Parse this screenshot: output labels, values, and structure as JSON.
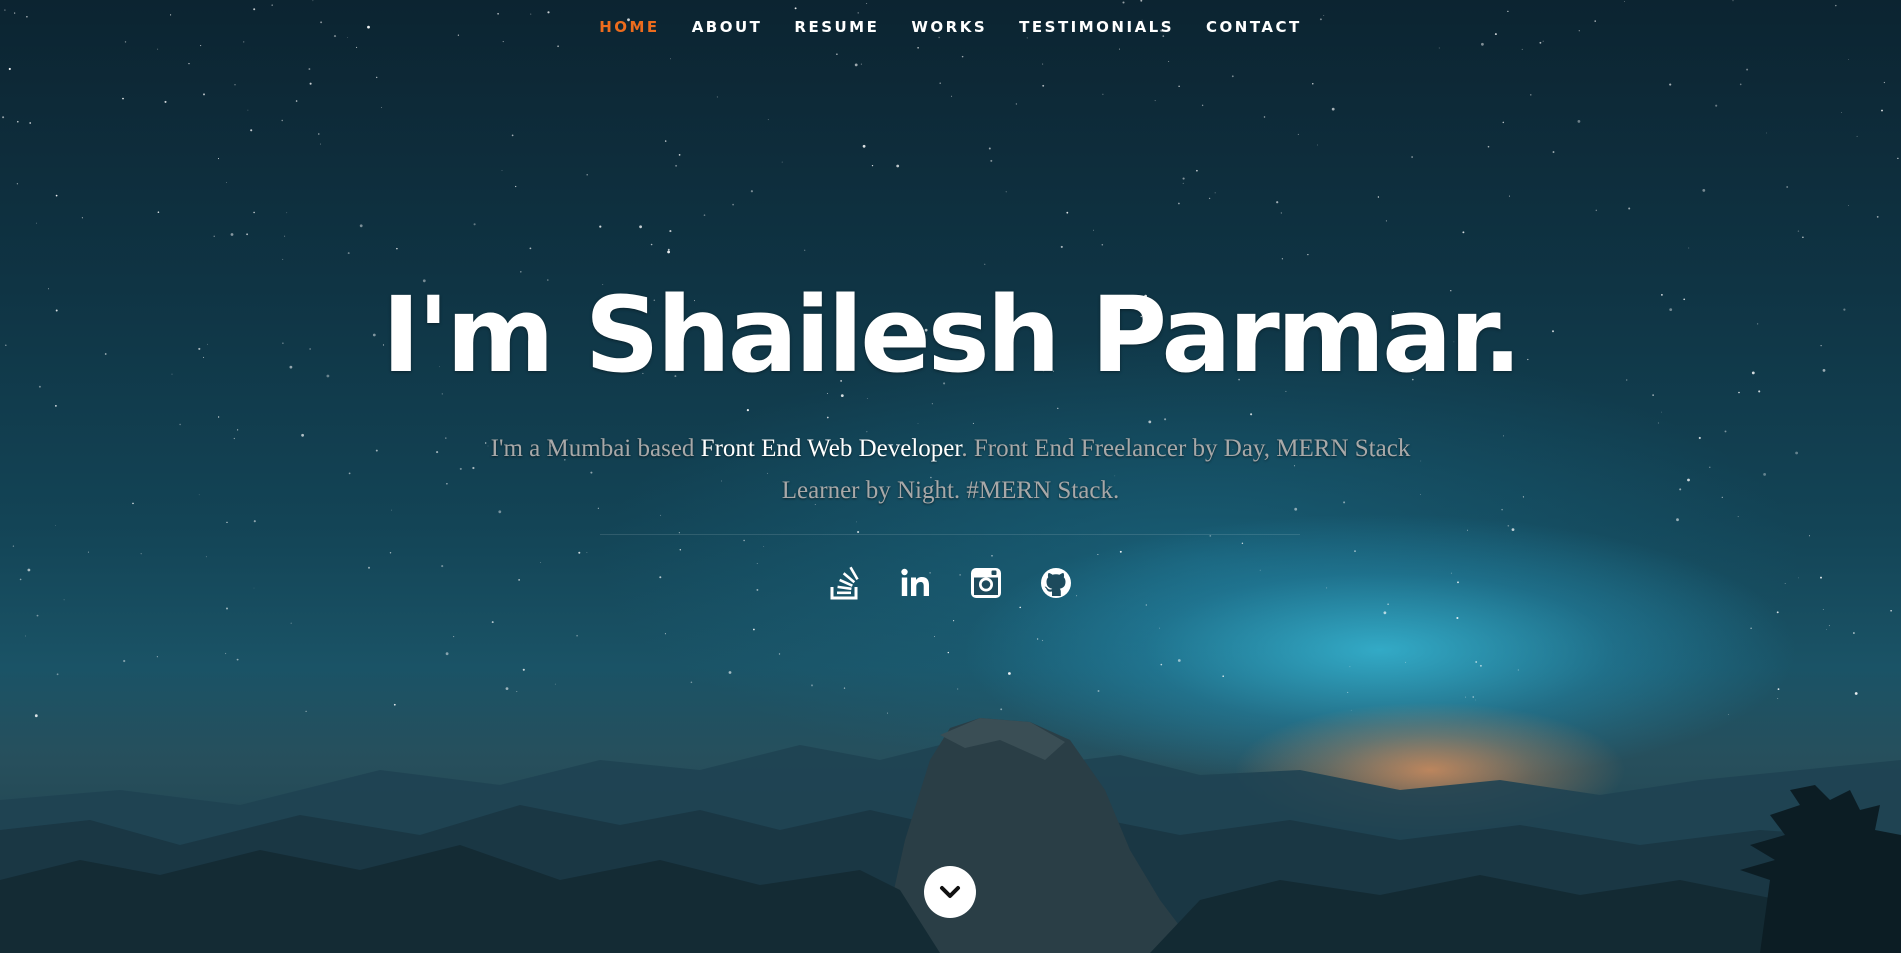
{
  "nav": {
    "items": [
      {
        "label": "HOME",
        "active": true
      },
      {
        "label": "ABOUT",
        "active": false
      },
      {
        "label": "RESUME",
        "active": false
      },
      {
        "label": "WORKS",
        "active": false
      },
      {
        "label": "TESTIMONIALS",
        "active": false
      },
      {
        "label": "CONTACT",
        "active": false
      }
    ],
    "active_color": "#ed6c1d"
  },
  "hero": {
    "title": "I'm Shailesh Parmar.",
    "subtitle_part1": "I'm a Mumbai based ",
    "subtitle_highlight": "Front End Web Developer",
    "subtitle_part2": ". Front End Freelancer by Day, MERN Stack Learner by Night. #MERN Stack."
  },
  "social": [
    {
      "icon": "stackoverflow-icon"
    },
    {
      "icon": "linkedin-icon"
    },
    {
      "icon": "instagram-icon"
    },
    {
      "icon": "github-icon"
    }
  ],
  "scroll": {
    "icon": "chevron-down-icon"
  }
}
